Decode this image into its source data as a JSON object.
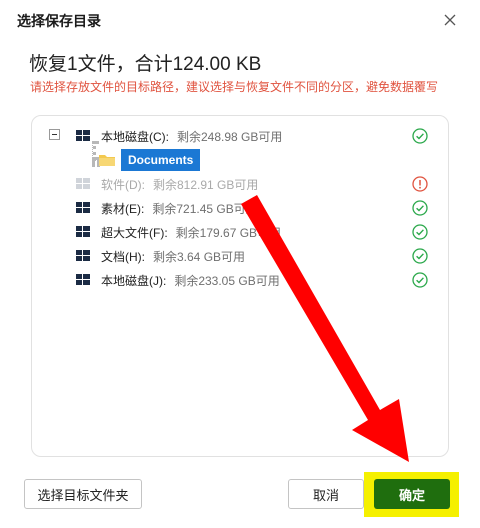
{
  "dialog": {
    "title": "选择保存目录",
    "heading": "恢复1文件，合计124.00 KB",
    "hint": "请选择存放文件的目标路径，建议选择与恢复文件不同的分区，避免数据覆写"
  },
  "tree": {
    "drives": [
      {
        "name": "本地磁盘(C):",
        "free": "剩余248.98 GB可用",
        "status": "ok-icon",
        "enabled": true
      },
      {
        "name": "软件(D):",
        "free": "剩余812.91 GB可用",
        "status": "warning-icon",
        "enabled": false
      },
      {
        "name": "素材(E):",
        "free": "剩余721.45 GB可用",
        "status": "ok-icon",
        "enabled": true
      },
      {
        "name": "超大文件(F):",
        "free": "剩余179.67 GB可用",
        "status": "ok-icon",
        "enabled": true
      },
      {
        "name": "文档(H):",
        "free": "剩余3.64 GB可用",
        "status": "ok-icon",
        "enabled": true
      },
      {
        "name": "本地磁盘(J):",
        "free": "剩余233.05 GB可用",
        "status": "ok-icon",
        "enabled": true
      }
    ],
    "selected_folder": "Documents"
  },
  "buttons": {
    "choose_folder": "选择目标文件夹",
    "cancel": "取消",
    "confirm": "确定"
  },
  "colors": {
    "accent": "#1b78d4",
    "confirm": "#1f6e0e",
    "ok": "#2aa84a",
    "warning": "#e0533f",
    "highlight": "#f5f000",
    "arrow": "#ff0000"
  }
}
